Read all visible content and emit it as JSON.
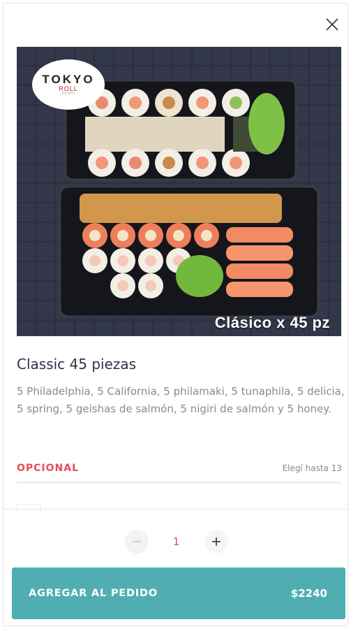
{
  "modal": {
    "close_icon": "close-icon"
  },
  "product": {
    "image_caption": "Clásico x 45 pz",
    "logo": {
      "top": "TOKYO",
      "middle": "ROLL",
      "sub": "SUSHI"
    },
    "title": "Classic 45 piezas",
    "description": "5 Philadelphia, 5 California, 5 philamaki, 5 tunaphila, 5 delicia, 5 spring, 5 geishas de salmón, 5 nigiri de salmón y 5 honey."
  },
  "options": {
    "badge": "OPCIONAL",
    "limit": "Elegí hasta 13"
  },
  "quantity": {
    "value": "1",
    "minus_icon": "minus-icon",
    "plus_icon": "plus-icon"
  },
  "cta": {
    "label": "AGREGAR AL PEDIDO",
    "price": "$2240"
  },
  "colors": {
    "accent": "#e84c5a",
    "cta": "#50aeb3",
    "title": "#2b3446",
    "muted": "#8a8a8a"
  }
}
